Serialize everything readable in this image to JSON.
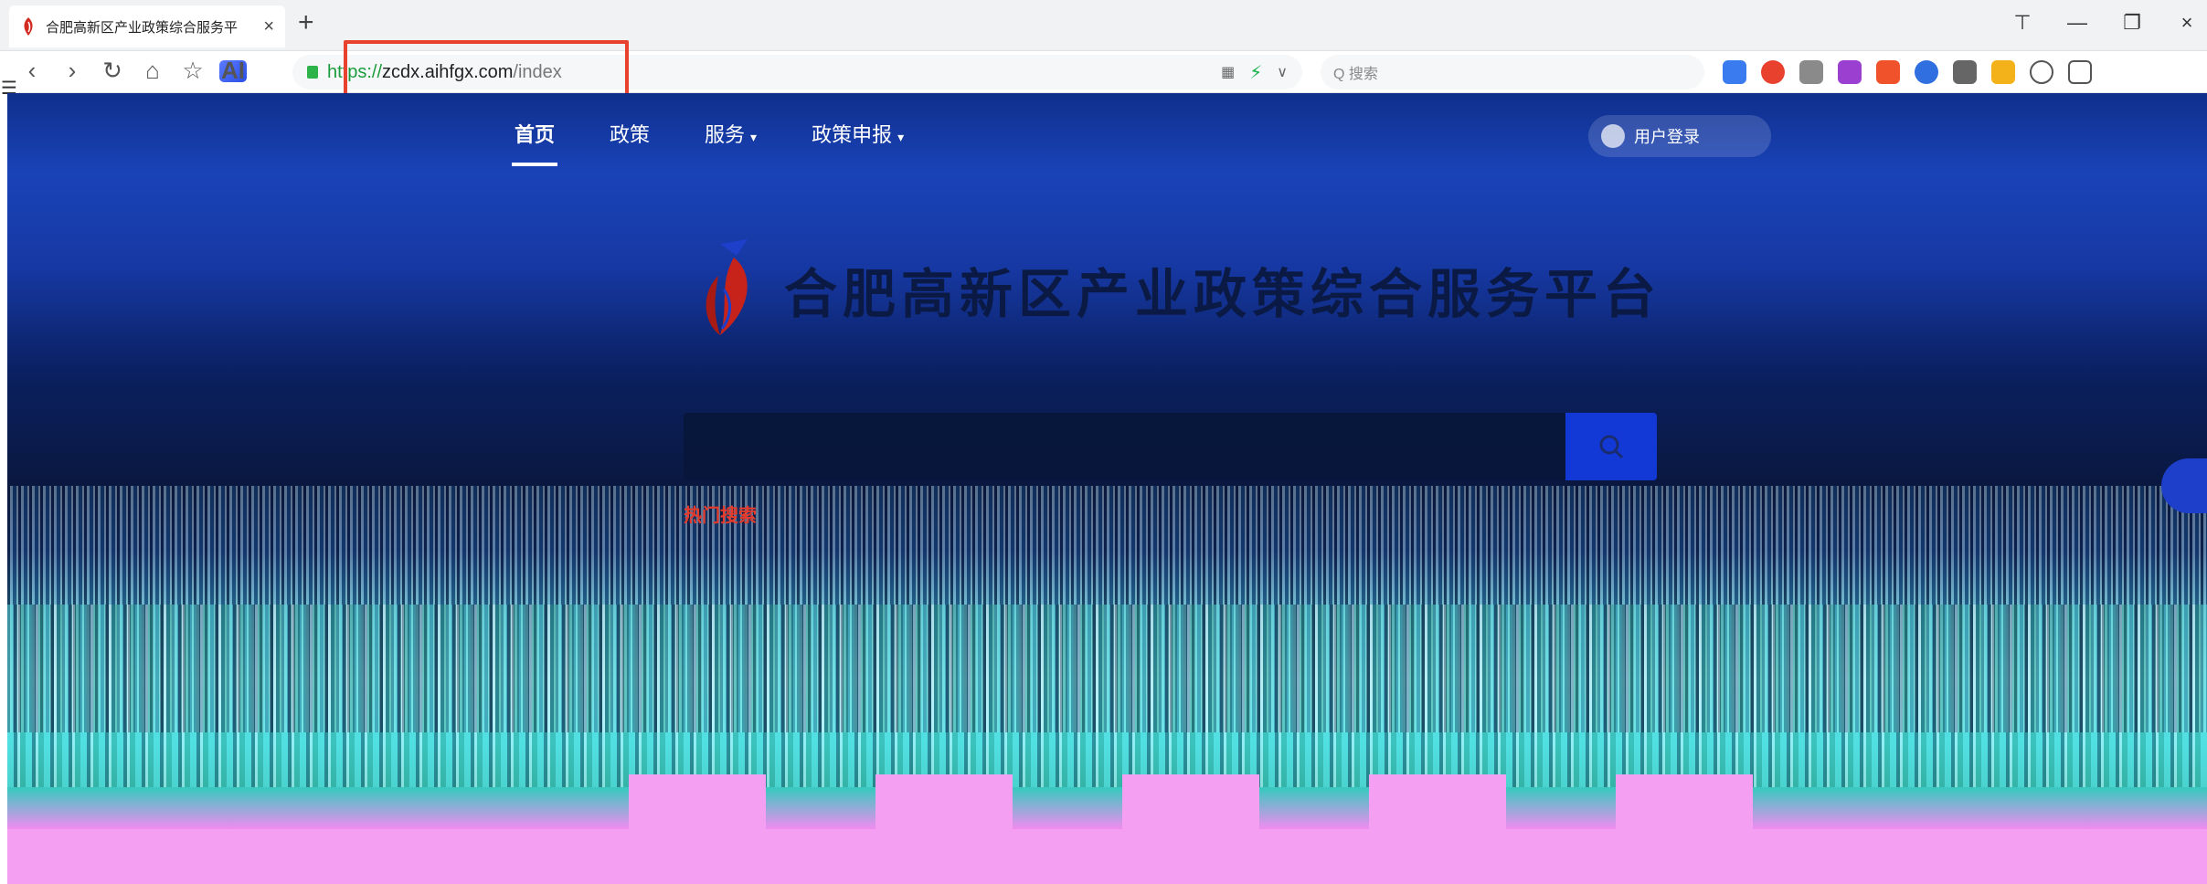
{
  "browser": {
    "tab_title": "合肥高新区产业政策综合服务平",
    "tab_close": "×",
    "new_tab": "+",
    "url_scheme": "https://",
    "url_host": "zcdx.aihfgx.com",
    "url_path": "/index",
    "nav": {
      "back": "‹",
      "forward": "›",
      "reload": "↻",
      "home": "⌂",
      "favorite": "☆",
      "ai": "AI"
    },
    "window": {
      "skin": "⊤",
      "minimize": "—",
      "restore": "❐",
      "close": "×"
    },
    "search_placeholder": "Q 搜索",
    "addr_extras": [
      "▦",
      "⚡",
      "∨"
    ],
    "left_menu": "☰"
  },
  "site": {
    "nav": [
      {
        "label": "首页",
        "active": true
      },
      {
        "label": "政策",
        "active": false
      },
      {
        "label": "服务",
        "active": false
      },
      {
        "label": "政策申报",
        "active": false
      }
    ],
    "caret": "▾",
    "login_label": "用户登录",
    "title": "合肥高新区产业政策综合服务平台",
    "search_placeholder": "",
    "hot_label": "热门搜索",
    "hot_items": [
      "",
      "",
      "",
      "",
      ""
    ]
  },
  "colors": {
    "primary": "#1239d6",
    "hero_top": "#0f2f8c",
    "url_highlight": "#e8412e",
    "title_text": "#0b1a45"
  },
  "icons": {
    "search": "search-icon",
    "logo": "logo-icon",
    "user": "user-icon"
  }
}
